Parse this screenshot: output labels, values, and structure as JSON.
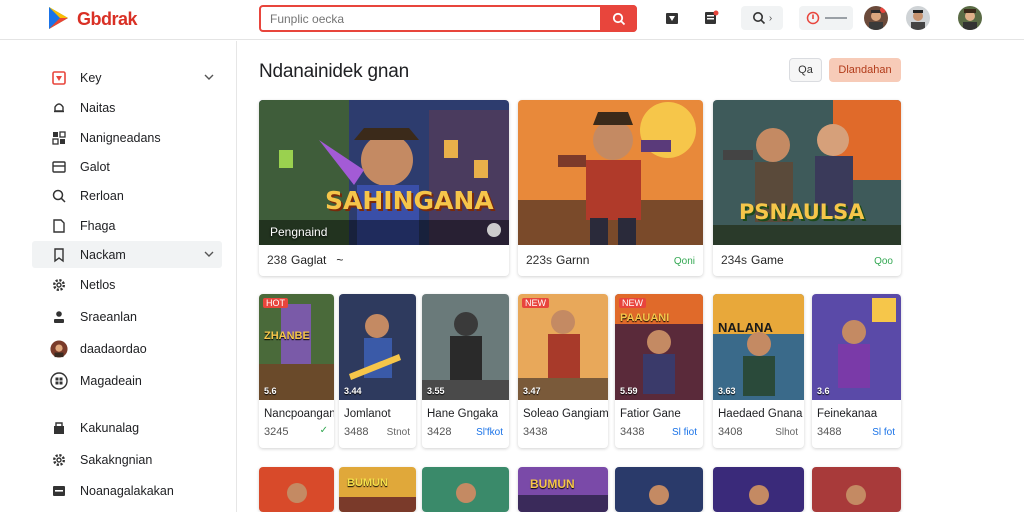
{
  "app": {
    "brand": "Gbdrak"
  },
  "search": {
    "placeholder": "Funplic oecka"
  },
  "header": {
    "icons": [
      "store-icon",
      "news-icon",
      "search-icon",
      "notification-icon"
    ],
    "notif_badge": "1"
  },
  "sidebar": {
    "items": [
      {
        "label": "Key",
        "icon": "home-icon",
        "chevron": true
      },
      {
        "label": "Naitas",
        "icon": "bell-icon"
      },
      {
        "label": "Nanigneadans",
        "icon": "apps-icon"
      },
      {
        "label": "Galot",
        "icon": "wallet-icon"
      },
      {
        "label": "Rerloan",
        "icon": "search-icon"
      },
      {
        "label": "Fhaga",
        "icon": "document-icon"
      },
      {
        "label": "Nackam",
        "icon": "bookmark-icon",
        "chevron": true,
        "active": true
      },
      {
        "label": "Netlos",
        "icon": "gear-icon"
      },
      {
        "label": "Sraeanlan",
        "icon": "person-icon"
      },
      {
        "label": "daadaordao",
        "icon": "avatar-icon"
      },
      {
        "label": "Magadeain",
        "icon": "grid-icon"
      },
      {
        "label": "Kakunalag",
        "icon": "shop-icon"
      },
      {
        "label": "Sakakngnian",
        "icon": "settings-icon"
      },
      {
        "label": "Noanagalakakan",
        "icon": "list-icon"
      }
    ]
  },
  "main": {
    "title": "Ndanainidek gnan",
    "filter_label": "Qa",
    "primary_label": "Dlandahan",
    "featured": [
      {
        "overlay": "SAHINGANA",
        "caption": "Pengnaind",
        "num": "238",
        "name": "Gaglat",
        "extra": "~",
        "badge": ""
      },
      {
        "overlay": "",
        "caption": "",
        "num": "223s",
        "name": "Garnn",
        "extra": "",
        "badge": "Qoni"
      },
      {
        "overlay": "PSNAULSA",
        "caption": "",
        "num": "234s",
        "name": "Game",
        "extra": "",
        "badge": "Qoo"
      }
    ],
    "small_games": [
      {
        "badge": "HOT",
        "title": "Nancpoangan",
        "num": "3245",
        "right": "✓",
        "overlay": "ZHANBE",
        "tag": "5.6"
      },
      {
        "badge": "",
        "title": "Jomlanot",
        "num": "3488",
        "right": "Stnot",
        "overlay": "",
        "tag": "3.44"
      },
      {
        "badge": "",
        "title": "Hane Gngaka",
        "num": "3428",
        "right": "Sl'fkot",
        "overlay": "",
        "tag": "3.55"
      },
      {
        "badge": "NEW",
        "title": "Soleao Gangiam",
        "num": "3438",
        "right": "",
        "overlay": "",
        "tag": "3.47"
      },
      {
        "badge": "NEW",
        "title": "Fatior Gane",
        "num": "3438",
        "right": "Sl fiot",
        "overlay": "PAAUANI",
        "tag": "5.59"
      },
      {
        "badge": "",
        "title": "Haedaed Gnana",
        "num": "3408",
        "right": "Slhot",
        "overlay": "NALANA",
        "tag": "3.63"
      },
      {
        "badge": "",
        "title": "Feinekanaa",
        "num": "3488",
        "right": "Sl fot",
        "overlay": "",
        "tag": "3.6"
      }
    ],
    "bottom_row_overlays": [
      "",
      "BUMUN",
      "",
      "BUMUN",
      "",
      "",
      ""
    ]
  },
  "colors": {
    "accent": "#e8453c",
    "green": "#34a853",
    "sidebar_active": "#f1f3f4"
  }
}
